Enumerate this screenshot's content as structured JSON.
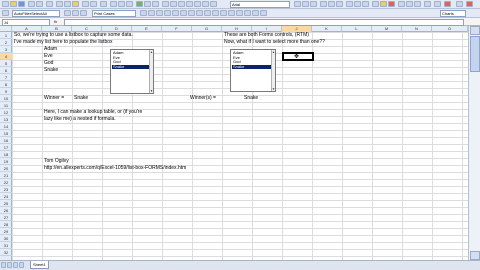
{
  "toolbar": {
    "font_name": "Arial",
    "zoom_label": "AutoFilterSelectAll",
    "print_label": "Print Cases",
    "charts_label": "Charts"
  },
  "formula_bar": {
    "name_box": "J4",
    "fx": "fx"
  },
  "columns": [
    "A",
    "B",
    "C",
    "D",
    "E",
    "F",
    "G",
    "H",
    "I",
    "J",
    "K",
    "L",
    "M",
    "N",
    "O"
  ],
  "rows": [
    "1",
    "2",
    "3",
    "4",
    "5",
    "6",
    "7",
    "8",
    "9",
    "10",
    "11",
    "12",
    "13",
    "14",
    "15",
    "16",
    "17",
    "18",
    "19",
    "20",
    "21",
    "22",
    "23",
    "24",
    "25",
    "26",
    "27",
    "28",
    "29",
    "30",
    "31",
    "32"
  ],
  "cells": {
    "a1": "So, we're trying to use a listbox to capture some data.",
    "a2": "I've made my list here to populate the listbox",
    "b3": "Adam",
    "b4": "Eve",
    "b5": "God",
    "b6": "Snake",
    "a10": "Winner =",
    "b10": "Snake",
    "g10": "Winner(s) =",
    "h10": "Snake",
    "a12": "Here, I can make a lookup table, or (if you're",
    "a13": "lazy like me) a nested if formula.",
    "a19": "Tom Ogilvy",
    "a20": "http://en.allexperts.com/q/Excel-1059/list-box-FORMS/index.htm",
    "g1": "These are both Forms controls, (RTM)",
    "g2": "Now, what if I want to select more than one??"
  },
  "listbox_single": {
    "items": [
      "Adam",
      "Eve",
      "God",
      "Snake"
    ],
    "selected": "Snake"
  },
  "listbox_multi": {
    "items": [
      "Adam",
      "Eve",
      "God",
      "Snake"
    ],
    "selected": "Snake"
  },
  "sheet_tabs": [
    "Sheet1"
  ]
}
